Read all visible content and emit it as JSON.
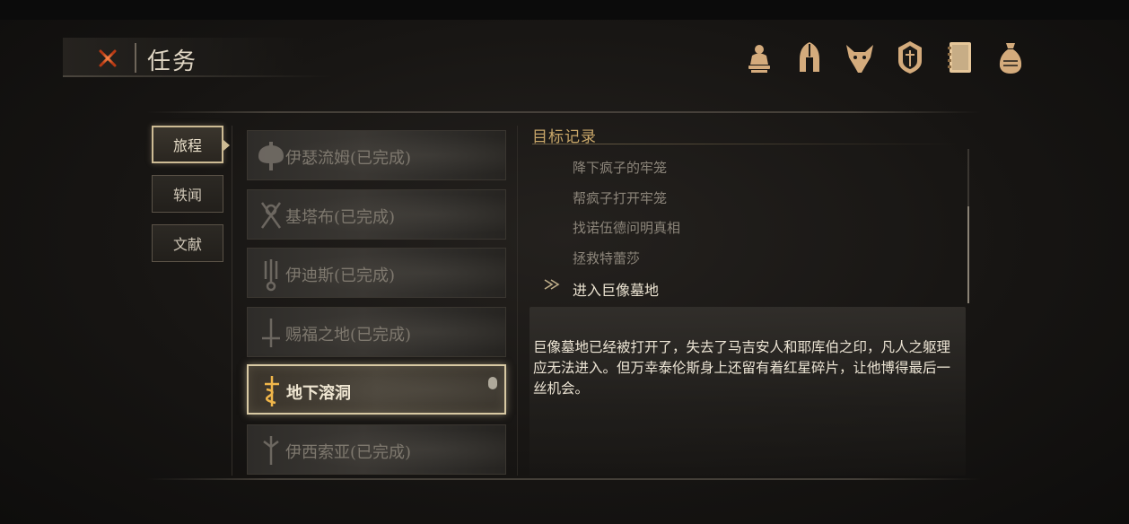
{
  "header": {
    "title": "任务",
    "close_icon": "close-x-icon"
  },
  "top_icons": [
    "character-statue-icon",
    "helmet-icon",
    "beast-mask-icon",
    "shield-crest-icon",
    "journal-book-icon",
    "coin-pouch-icon"
  ],
  "categories": [
    {
      "label": "旅程",
      "active": true
    },
    {
      "label": "轶闻",
      "active": false
    },
    {
      "label": "文献",
      "active": false
    }
  ],
  "quests": [
    {
      "label": "伊瑟流姆(已完成)",
      "icon": "axe-emblem-icon",
      "active": false
    },
    {
      "label": "基塔布(已完成)",
      "icon": "crossed-swords-emblem-icon",
      "active": false
    },
    {
      "label": "伊迪斯(已完成)",
      "icon": "trident-emblem-icon",
      "active": false
    },
    {
      "label": "赐福之地(已完成)",
      "icon": "sword-emblem-icon",
      "active": false
    },
    {
      "label": "地下溶洞",
      "icon": "serpent-dagger-emblem-icon",
      "active": true
    },
    {
      "label": "伊西索亚(已完成)",
      "icon": "staff-emblem-icon",
      "active": false
    }
  ],
  "objectives": {
    "title": "目标记录",
    "items": [
      {
        "text": "降下疯子的牢笼",
        "current": false
      },
      {
        "text": "帮疯子打开牢笼",
        "current": false
      },
      {
        "text": "找诺伍德问明真相",
        "current": false
      },
      {
        "text": "拯救特蕾莎",
        "current": false
      },
      {
        "text": "进入巨像墓地",
        "current": true
      }
    ],
    "description": "巨像墓地已经被打开了，失去了马吉安人和耶库伯之印，凡人之躯理应无法进入。但万幸泰伦斯身上还留有着红星碎片，让他博得最后一丝机会。"
  },
  "colors": {
    "accent_gold": "#c9a769",
    "close_orange": "#e0582a",
    "active_border": "#d8c9a3"
  }
}
